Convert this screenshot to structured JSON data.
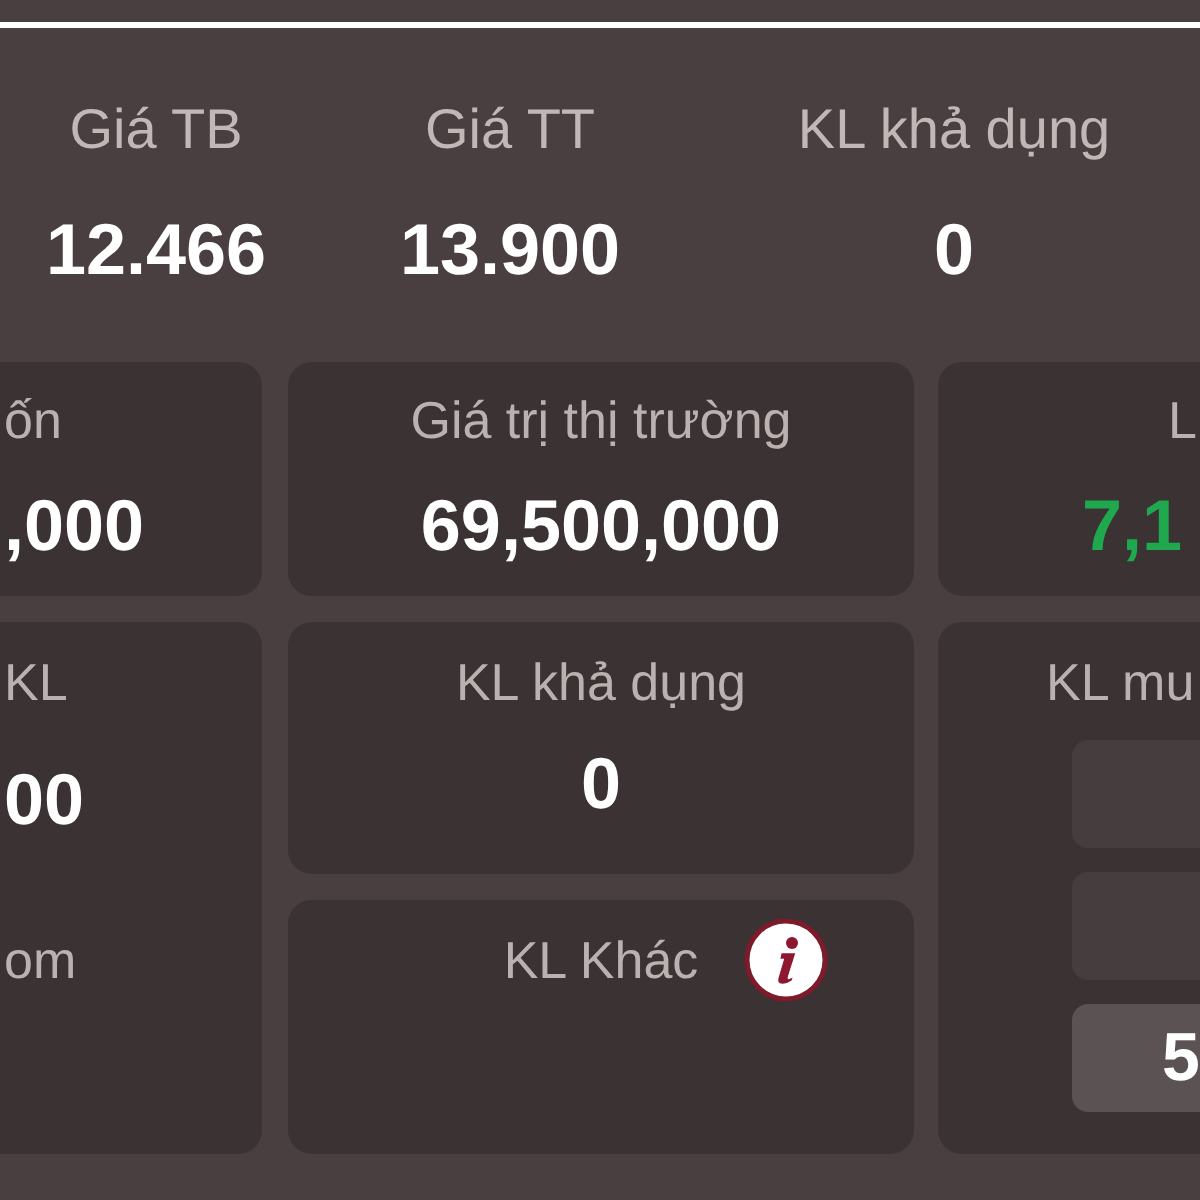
{
  "header": {
    "stats": [
      {
        "label": "Giá TB",
        "value": "12.466"
      },
      {
        "label": "Giá TT",
        "value": "13.900"
      },
      {
        "label": "KL khả dụng",
        "value": "0"
      }
    ]
  },
  "summary_cards": [
    {
      "label": "ốn",
      "value": ",000",
      "color": "#ffffff"
    },
    {
      "label": "Giá trị thị trường",
      "value": "69,500,000",
      "color": "#ffffff"
    },
    {
      "label": "L",
      "value": "7,1",
      "color": "#1fa84e"
    }
  ],
  "left_card": {
    "label": "KL",
    "value": "00",
    "note": "om"
  },
  "middle_cards": [
    {
      "label": "KL khả dụng",
      "value": "0",
      "info_icon": false
    },
    {
      "label": "KL Khác",
      "info_icon": true
    }
  ],
  "right_card": {
    "label": "KL mu",
    "slots": [
      {
        "selected": false
      },
      {
        "selected": false
      },
      {
        "value": "5",
        "selected": true
      }
    ]
  }
}
